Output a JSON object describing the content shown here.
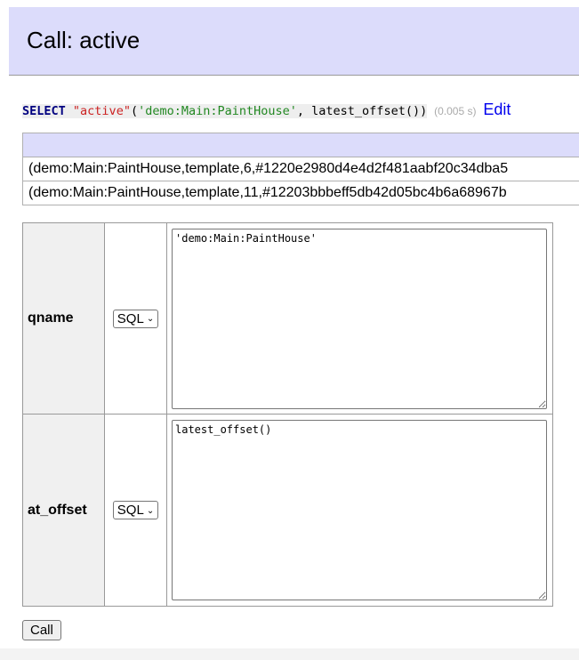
{
  "header": {
    "title": "Call: active"
  },
  "query": {
    "keyword": "SELECT",
    "function_name": "\"active\"",
    "open_paren": "(",
    "arg_string": "'demo:Main:PaintHouse'",
    "rest": ", latest_offset())",
    "timing": "(0.005 s)",
    "edit_label": "Edit"
  },
  "results": {
    "rows": [
      "(demo:Main:PaintHouse,template,6,#1220e2980d4e4d2f481aabf20c34dba5",
      "(demo:Main:PaintHouse,template,11,#12203bbbeff5db42d05bc4b6a68967b"
    ]
  },
  "params": [
    {
      "name": "qname",
      "type": "SQL",
      "value": "'demo:Main:PaintHouse'"
    },
    {
      "name": "at_offset",
      "type": "SQL",
      "value": "latest_offset()"
    }
  ],
  "call_button": "Call"
}
